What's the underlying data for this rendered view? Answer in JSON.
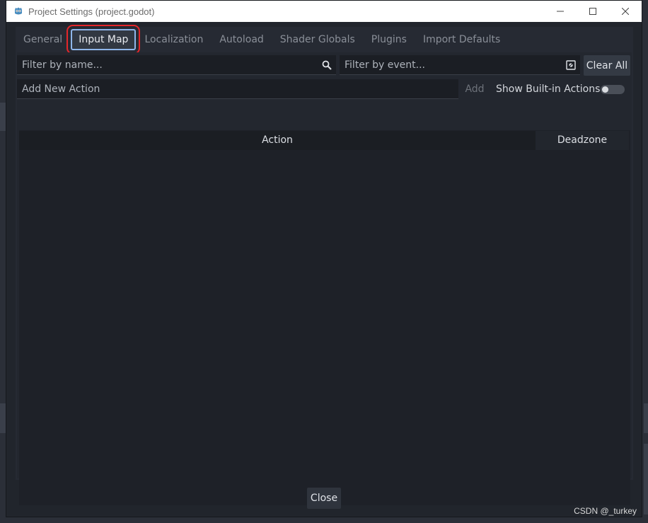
{
  "window": {
    "title": "Project Settings (project.godot)",
    "controls": [
      "minimize-icon",
      "maximize-icon",
      "close-icon"
    ]
  },
  "tabs": [
    {
      "label": "General",
      "active": false
    },
    {
      "label": "Input Map",
      "active": true
    },
    {
      "label": "Localization",
      "active": false
    },
    {
      "label": "Autoload",
      "active": false
    },
    {
      "label": "Shader Globals",
      "active": false
    },
    {
      "label": "Plugins",
      "active": false
    },
    {
      "label": "Import Defaults",
      "active": false
    }
  ],
  "filters": {
    "name_placeholder": "Filter by name...",
    "event_placeholder": "Filter by event...",
    "clear_all_label": "Clear All"
  },
  "new_action": {
    "placeholder": "Add New Action",
    "add_label": "Add",
    "show_builtin_label": "Show Built-in Actions",
    "show_builtin_on": false
  },
  "table": {
    "columns": [
      "Action",
      "Deadzone"
    ]
  },
  "footer": {
    "close_label": "Close"
  },
  "watermark": "CSDN @_turkey",
  "colors": {
    "accent": "#8fb6ea",
    "highlight": "#e5262a",
    "panel": "#23272f"
  }
}
